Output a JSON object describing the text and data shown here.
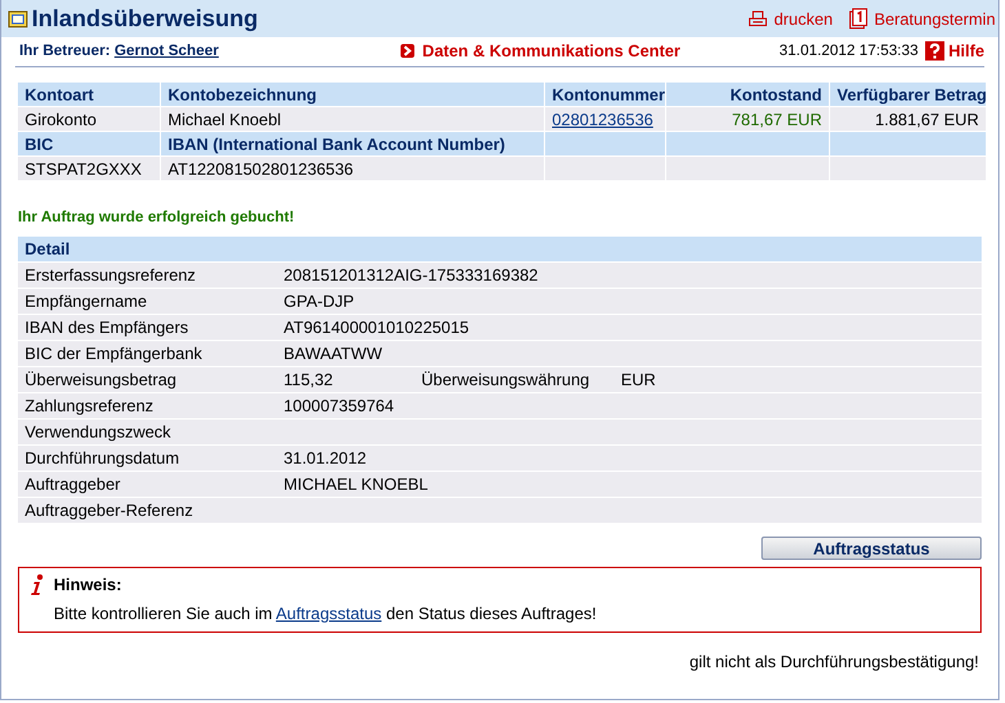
{
  "header": {
    "title": "Inlandsüberweisung",
    "actions": [
      {
        "kind": "print",
        "label": "drucken"
      },
      {
        "kind": "calendar",
        "label": "Beratungstermin"
      }
    ]
  },
  "subheader": {
    "advisor_label": "Ihr Betreuer:",
    "advisor_name": "Gernot Scheer",
    "center_link": "Daten & Kommunikations Center",
    "datetime": "31.01.2012 17:53:33",
    "help": "Hilfe"
  },
  "account": {
    "columns": [
      "Kontoart",
      "Kontobezeichnung",
      "Kontonummer",
      "Kontostand",
      "Verfügbarer Betrag"
    ],
    "row": {
      "type": "Girokonto",
      "name": "Michael Knoebl",
      "number": "02801236536",
      "balance": "781,67 EUR",
      "available": "1.881,67 EUR"
    },
    "columns2": [
      "BIC",
      "IBAN (International Bank Account Number)"
    ],
    "row2": {
      "bic": "STSPAT2GXXX",
      "iban": "AT122081502801236536"
    }
  },
  "success_message": "Ihr Auftrag wurde erfolgreich gebucht!",
  "detail": {
    "title": "Detail",
    "rows": [
      {
        "label": "Ersterfassungsreferenz",
        "value": "208151201312AIG-175333169382"
      },
      {
        "label": "Empfängername",
        "value": "GPA-DJP"
      },
      {
        "label": "IBAN des Empfängers",
        "value": "AT961400001010225015"
      },
      {
        "label": "BIC der Empfängerbank",
        "value": "BAWAATWW"
      },
      {
        "label": "Überweisungsbetrag",
        "value": "115,32",
        "extra_label": "Überweisungswährung",
        "extra_value": "EUR"
      },
      {
        "label": "Zahlungsreferenz",
        "value": "100007359764"
      },
      {
        "label": "Verwendungszweck"
      },
      {
        "label": "Durchführungsdatum",
        "value": "31.01.2012"
      },
      {
        "label": "Auftraggeber",
        "value": "MICHAEL KNOEBL"
      },
      {
        "label": "Auftraggeber-Referenz"
      }
    ]
  },
  "status_button": "Auftragsstatus",
  "notice": {
    "title": "Hinweis:",
    "before": "Bitte kontrollieren Sie auch im",
    "link": "Auftragsstatus",
    "after": "den Status dieses Auftrages!"
  },
  "footer_note": "gilt nicht als Durchführungsbestätigung!"
}
